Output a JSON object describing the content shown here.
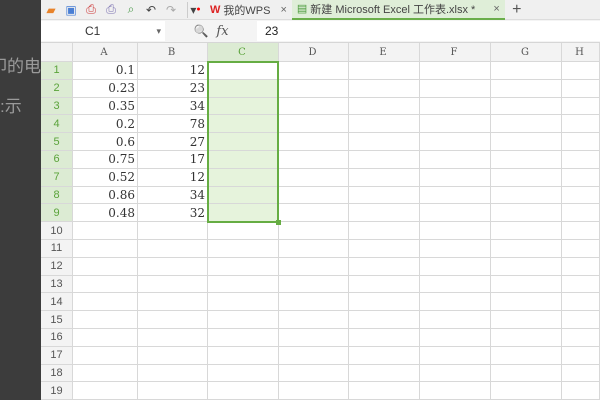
{
  "background_text": [
    "叩的电",
    "示:"
  ],
  "toolbar": {
    "icons": [
      "open-icon",
      "save-icon",
      "export-pdf-icon",
      "print-icon",
      "print-preview-icon",
      "undo-icon",
      "redo-icon",
      "dropdown-icon"
    ],
    "tabs": [
      {
        "label": "我的WPS",
        "close": "×"
      },
      {
        "label": "新建 Microsoft Excel 工作表.xlsx *",
        "close": "×"
      }
    ],
    "new_tab": "+"
  },
  "formula_bar": {
    "name_box": "C1",
    "dropdown": "▾",
    "zoom_icon": "🔍",
    "fx": "fx",
    "value": "23"
  },
  "columns": [
    "A",
    "B",
    "C",
    "D",
    "E",
    "F",
    "G",
    "H"
  ],
  "rows": [
    "1",
    "2",
    "3",
    "4",
    "5",
    "6",
    "7",
    "8",
    "9",
    "10",
    "11",
    "12",
    "13",
    "14",
    "15",
    "16",
    "17",
    "18",
    "19"
  ],
  "data": {
    "A": [
      "0.1",
      "0.23",
      "0.35",
      "0.2",
      "0.6",
      "0.75",
      "0.52",
      "0.86",
      "0.48"
    ],
    "B": [
      "12",
      "23",
      "34",
      "78",
      "27",
      "17",
      "12",
      "34",
      "32"
    ]
  },
  "selection": {
    "active_cell": "C1",
    "range": "C1:C9",
    "accent": "#66ad43"
  }
}
